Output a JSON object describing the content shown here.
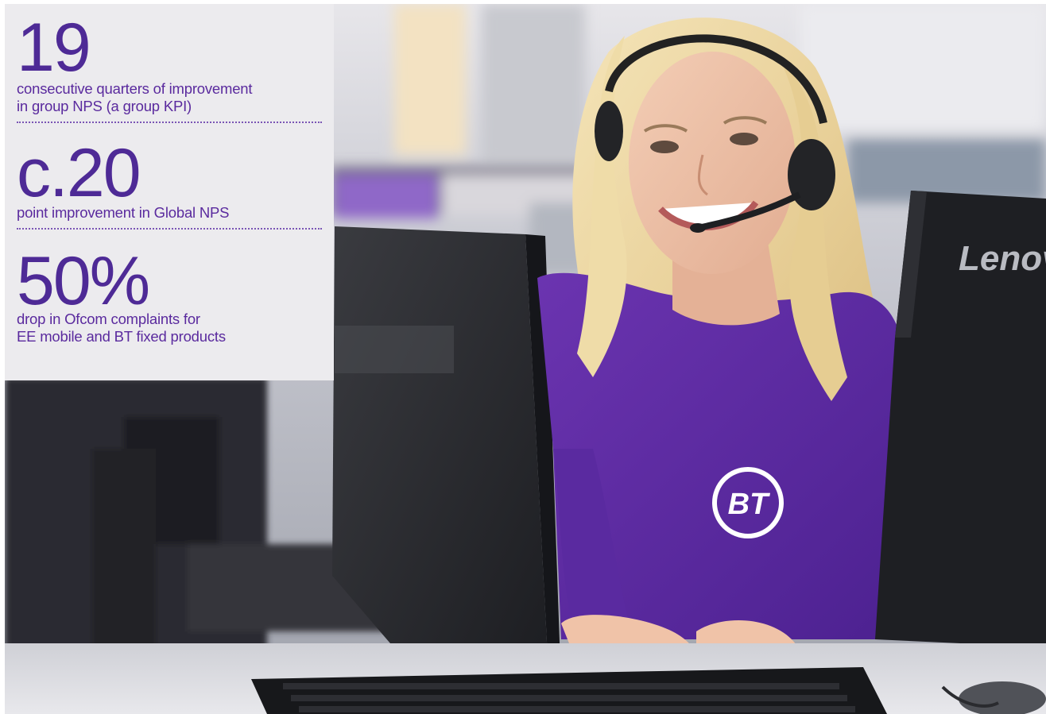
{
  "stats": [
    {
      "value": "19",
      "label_line1": "consecutive quarters of improvement",
      "label_line2": "in group NPS (a group KPI)"
    },
    {
      "value": "c.20",
      "label_line1": "point improvement in Global NPS",
      "label_line2": ""
    },
    {
      "value": "50%",
      "label_line1": "drop in Ofcom complaints for",
      "label_line2": "EE mobile and BT fixed products"
    }
  ],
  "photo": {
    "shirt_logo": "BT",
    "monitor_brand": "Lenovo"
  },
  "colors": {
    "brand_purple": "#5a2a9e",
    "panel_background": "#ecebee",
    "shirt_purple": "#5b2aa0"
  }
}
